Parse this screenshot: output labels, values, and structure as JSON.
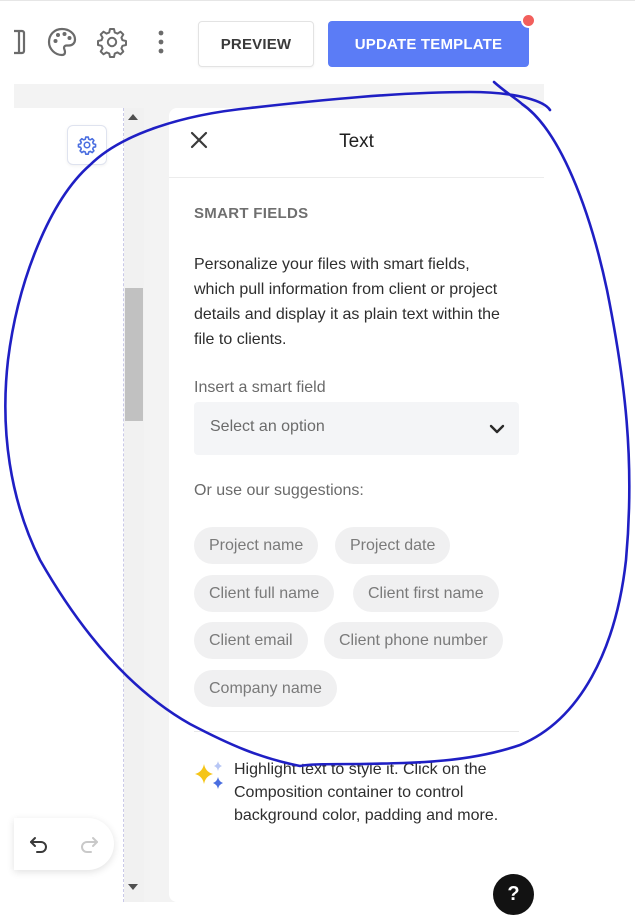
{
  "toolbar": {
    "icons": [
      "layout-panel-icon",
      "palette-icon",
      "gear-icon",
      "more-vertical-icon"
    ],
    "preview_label": "PREVIEW",
    "update_label": "UPDATE TEMPLATE",
    "update_color": "#5b7cf6",
    "notification_color": "#f25f5c"
  },
  "panel": {
    "title": "Text",
    "section_title": "SMART FIELDS",
    "description": "Personalize your files with smart fields, which pull information from client or project details and display it as plain text within the file to clients.",
    "insert_label": "Insert a smart field",
    "select_placeholder": "Select an option",
    "suggestions_label": "Or use our suggestions:",
    "suggestions": [
      "Project name",
      "Project date",
      "Client full name",
      "Client first name",
      "Client email",
      "Client phone number",
      "Company name"
    ],
    "tip": "Highlight text to style it. Click on the Composition container to control background color, padding and more."
  },
  "help": {
    "label": "?"
  },
  "annotation": {
    "color": "#1f1fc4"
  }
}
